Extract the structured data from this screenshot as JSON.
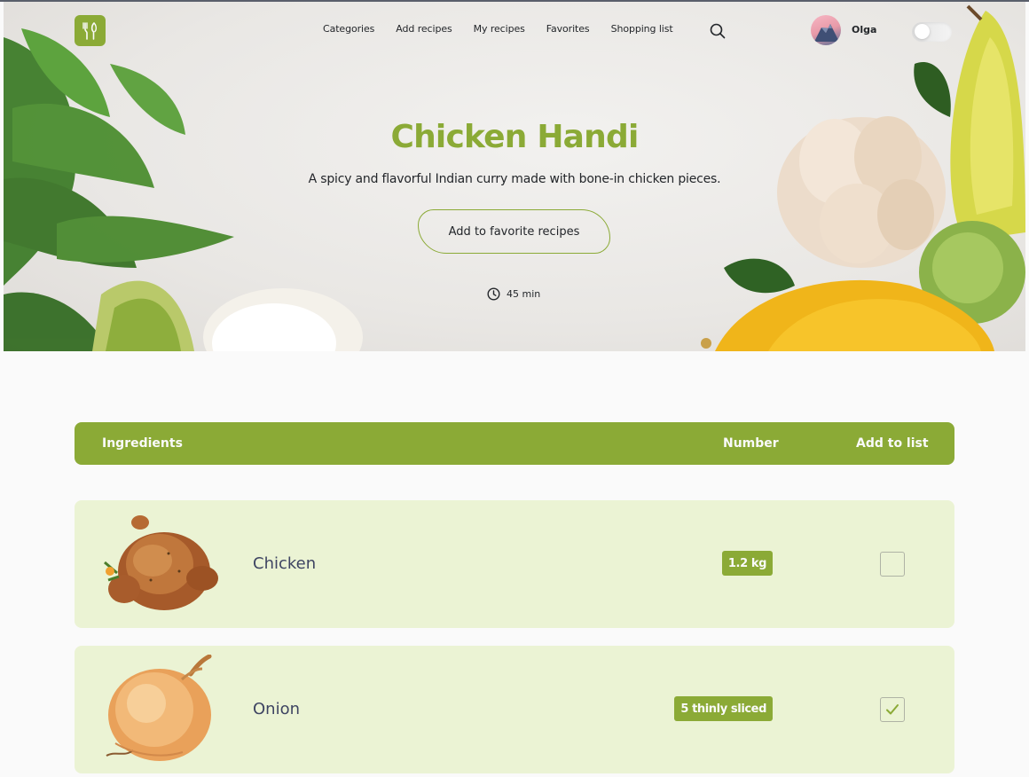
{
  "nav": {
    "items": [
      "Categories",
      "Add recipes",
      "My recipes",
      "Favorites",
      "Shopping list"
    ]
  },
  "user": {
    "name": "Olga"
  },
  "recipe": {
    "title": "Chicken Handi",
    "description": "A spicy and flavorful Indian curry made with bone-in chicken pieces.",
    "favorite_button": "Add to favorite recipes",
    "time": "45 min"
  },
  "table": {
    "headers": [
      "Ingredients",
      "Number",
      "Add to list"
    ],
    "rows": [
      {
        "name": "Chicken",
        "number": "1.2 kg",
        "checked": false,
        "image": "chicken-image"
      },
      {
        "name": "Onion",
        "number": "5 thinly sliced",
        "checked": true,
        "image": "onion-image"
      }
    ]
  },
  "theme": {
    "accent": "#8baa36",
    "row_bg": "#ebf3d4",
    "text": "#3e4462"
  }
}
